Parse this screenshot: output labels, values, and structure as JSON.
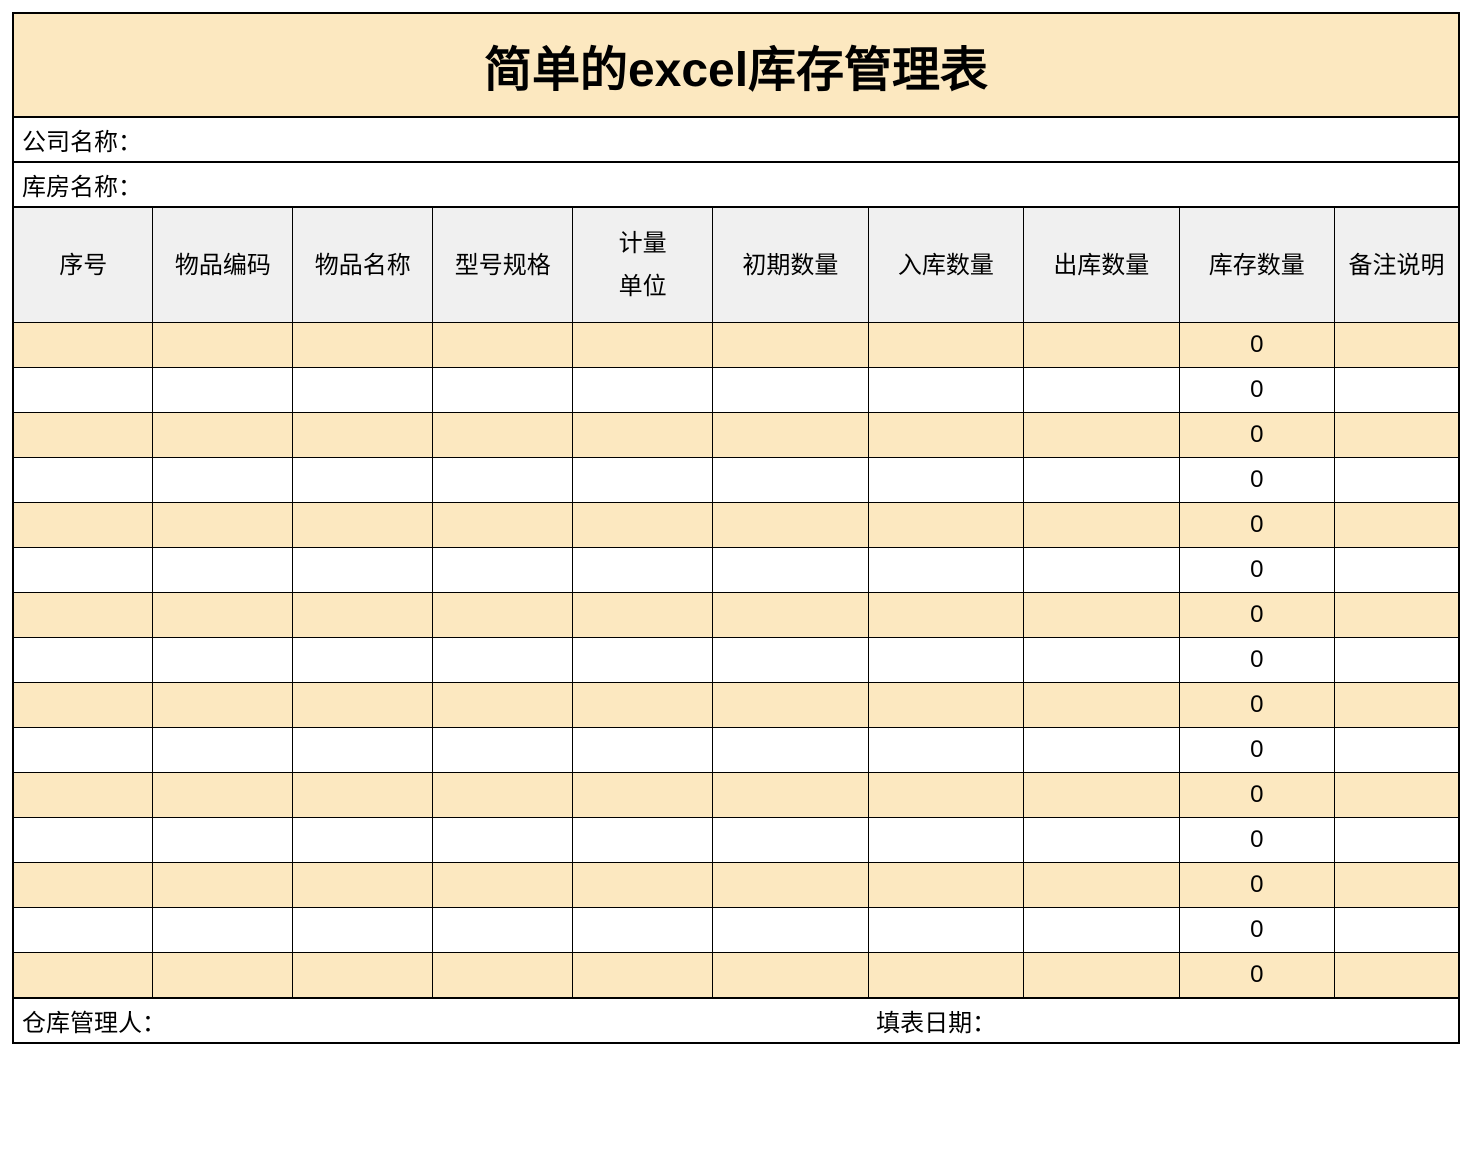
{
  "title": "简单的excel库存管理表",
  "company_label": "公司名称：",
  "warehouse_label": "库房名称：",
  "headers": {
    "col1": "序号",
    "col2": "物品编码",
    "col3": "物品名称",
    "col4": "型号规格",
    "col5": "计量\n单位",
    "col6": "初期数量",
    "col7": "入库数量",
    "col8": "出库数量",
    "col9": "库存数量",
    "col10": "备注说明"
  },
  "rows": [
    {
      "c1": "",
      "c2": "",
      "c3": "",
      "c4": "",
      "c5": "",
      "c6": "",
      "c7": "",
      "c8": "",
      "c9": "0",
      "c10": ""
    },
    {
      "c1": "",
      "c2": "",
      "c3": "",
      "c4": "",
      "c5": "",
      "c6": "",
      "c7": "",
      "c8": "",
      "c9": "0",
      "c10": ""
    },
    {
      "c1": "",
      "c2": "",
      "c3": "",
      "c4": "",
      "c5": "",
      "c6": "",
      "c7": "",
      "c8": "",
      "c9": "0",
      "c10": ""
    },
    {
      "c1": "",
      "c2": "",
      "c3": "",
      "c4": "",
      "c5": "",
      "c6": "",
      "c7": "",
      "c8": "",
      "c9": "0",
      "c10": ""
    },
    {
      "c1": "",
      "c2": "",
      "c3": "",
      "c4": "",
      "c5": "",
      "c6": "",
      "c7": "",
      "c8": "",
      "c9": "0",
      "c10": ""
    },
    {
      "c1": "",
      "c2": "",
      "c3": "",
      "c4": "",
      "c5": "",
      "c6": "",
      "c7": "",
      "c8": "",
      "c9": "0",
      "c10": ""
    },
    {
      "c1": "",
      "c2": "",
      "c3": "",
      "c4": "",
      "c5": "",
      "c6": "",
      "c7": "",
      "c8": "",
      "c9": "0",
      "c10": ""
    },
    {
      "c1": "",
      "c2": "",
      "c3": "",
      "c4": "",
      "c5": "",
      "c6": "",
      "c7": "",
      "c8": "",
      "c9": "0",
      "c10": ""
    },
    {
      "c1": "",
      "c2": "",
      "c3": "",
      "c4": "",
      "c5": "",
      "c6": "",
      "c7": "",
      "c8": "",
      "c9": "0",
      "c10": ""
    },
    {
      "c1": "",
      "c2": "",
      "c3": "",
      "c4": "",
      "c5": "",
      "c6": "",
      "c7": "",
      "c8": "",
      "c9": "0",
      "c10": ""
    },
    {
      "c1": "",
      "c2": "",
      "c3": "",
      "c4": "",
      "c5": "",
      "c6": "",
      "c7": "",
      "c8": "",
      "c9": "0",
      "c10": ""
    },
    {
      "c1": "",
      "c2": "",
      "c3": "",
      "c4": "",
      "c5": "",
      "c6": "",
      "c7": "",
      "c8": "",
      "c9": "0",
      "c10": ""
    },
    {
      "c1": "",
      "c2": "",
      "c3": "",
      "c4": "",
      "c5": "",
      "c6": "",
      "c7": "",
      "c8": "",
      "c9": "0",
      "c10": ""
    },
    {
      "c1": "",
      "c2": "",
      "c3": "",
      "c4": "",
      "c5": "",
      "c6": "",
      "c7": "",
      "c8": "",
      "c9": "0",
      "c10": ""
    },
    {
      "c1": "",
      "c2": "",
      "c3": "",
      "c4": "",
      "c5": "",
      "c6": "",
      "c7": "",
      "c8": "",
      "c9": "0",
      "c10": ""
    }
  ],
  "footer": {
    "manager_label": "仓库管理人：",
    "date_label": "填表日期："
  },
  "col_widths": [
    "9%",
    "9%",
    "9%",
    "9%",
    "9%",
    "10%",
    "10%",
    "10%",
    "10%",
    "8%"
  ]
}
